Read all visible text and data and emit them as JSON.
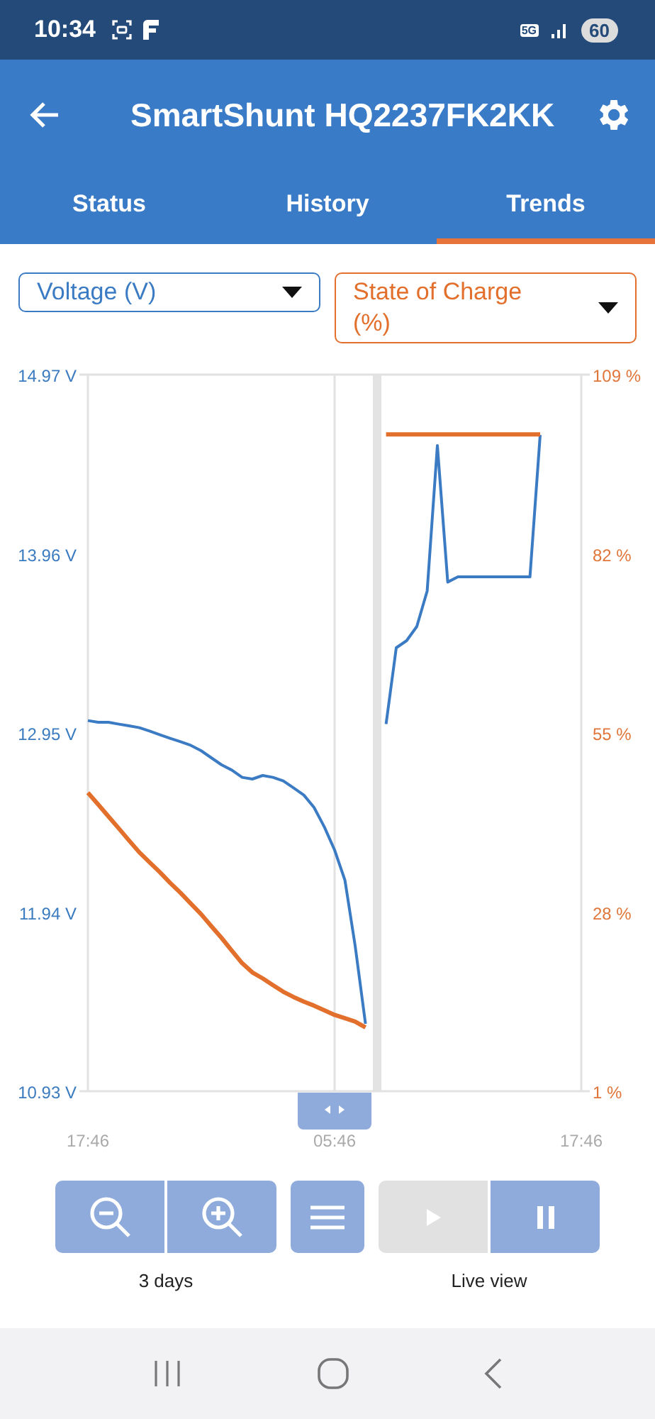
{
  "status_bar": {
    "time": "10:34",
    "network": "5G",
    "battery": "60"
  },
  "header": {
    "title": "SmartShunt HQ2237FK2KK"
  },
  "tabs": [
    {
      "label": "Status",
      "selected": false
    },
    {
      "label": "History",
      "selected": false
    },
    {
      "label": "Trends",
      "selected": true
    }
  ],
  "chart_data": {
    "type": "line",
    "grid": true,
    "categories": [
      "17:46",
      null,
      null,
      null,
      null,
      null,
      null,
      null,
      null,
      null,
      null,
      null,
      null,
      null,
      null,
      null,
      null,
      null,
      null,
      null,
      null,
      null,
      null,
      null,
      "05:46",
      null,
      null,
      null,
      null,
      null,
      null,
      null,
      null,
      null,
      null,
      null,
      null,
      null,
      null,
      null,
      null,
      null,
      null,
      null,
      null,
      null,
      null,
      null,
      "17:46"
    ],
    "ylim": [
      10.93,
      14.97
    ],
    "yticks": [
      {
        "value": 14.97,
        "label": "14.97 V"
      },
      {
        "value": 13.96,
        "label": "13.96 V"
      },
      {
        "value": 12.95,
        "label": "12.95 V"
      },
      {
        "value": 11.94,
        "label": "11.94 V"
      },
      {
        "value": 10.93,
        "label": "10.93 V"
      }
    ],
    "y2lim": [
      1,
      109
    ],
    "y2ticks": [
      {
        "value": 109,
        "label": "109 %"
      },
      {
        "value": 82,
        "label": "82 %"
      },
      {
        "value": 55,
        "label": "55 %"
      },
      {
        "value": 28,
        "label": "28 %"
      },
      {
        "value": 1,
        "label": "1 %"
      }
    ],
    "series": [
      {
        "name": "Voltage (V)",
        "color": "#3b7bc4",
        "values": [
          13.02,
          13.01,
          13.01,
          13.0,
          12.99,
          12.98,
          12.96,
          12.94,
          12.92,
          12.9,
          12.88,
          12.85,
          12.81,
          12.77,
          12.74,
          12.7,
          12.69,
          12.71,
          12.7,
          12.68,
          12.64,
          12.6,
          12.53,
          12.42,
          12.29,
          12.12,
          11.75,
          11.31,
          null,
          13.0,
          13.43,
          13.47,
          13.55,
          13.75,
          14.57,
          13.8,
          13.83,
          13.83,
          13.83,
          13.83,
          13.83,
          13.83,
          13.83,
          13.83,
          14.63,
          null,
          null,
          null,
          null
        ]
      },
      {
        "name": "State of Charge (%)",
        "axis": "y2",
        "color": "#e36f2c",
        "values": [
          46,
          44.2,
          42.4,
          40.6,
          38.8,
          37.0,
          35.5,
          34.0,
          32.4,
          30.9,
          29.3,
          27.7,
          25.9,
          24.1,
          22.2,
          20.3,
          18.9,
          18.0,
          17.0,
          16.0,
          15.2,
          14.5,
          13.9,
          13.2,
          12.5,
          12.0,
          11.5,
          10.6,
          null,
          100,
          100,
          100,
          100,
          100,
          100,
          100,
          100,
          100,
          100,
          100,
          100,
          100,
          100,
          100,
          100,
          null,
          null,
          null,
          null
        ]
      }
    ]
  },
  "controls": [
    {
      "kind": "zoom_out",
      "disabled": false
    },
    {
      "kind": "zoom_in",
      "disabled": false
    },
    {
      "kind": "menu",
      "disabled": false
    },
    {
      "kind": "play",
      "disabled": true
    },
    {
      "kind": "pause",
      "disabled": false
    }
  ],
  "captions": [
    "3 days",
    "Live view"
  ]
}
